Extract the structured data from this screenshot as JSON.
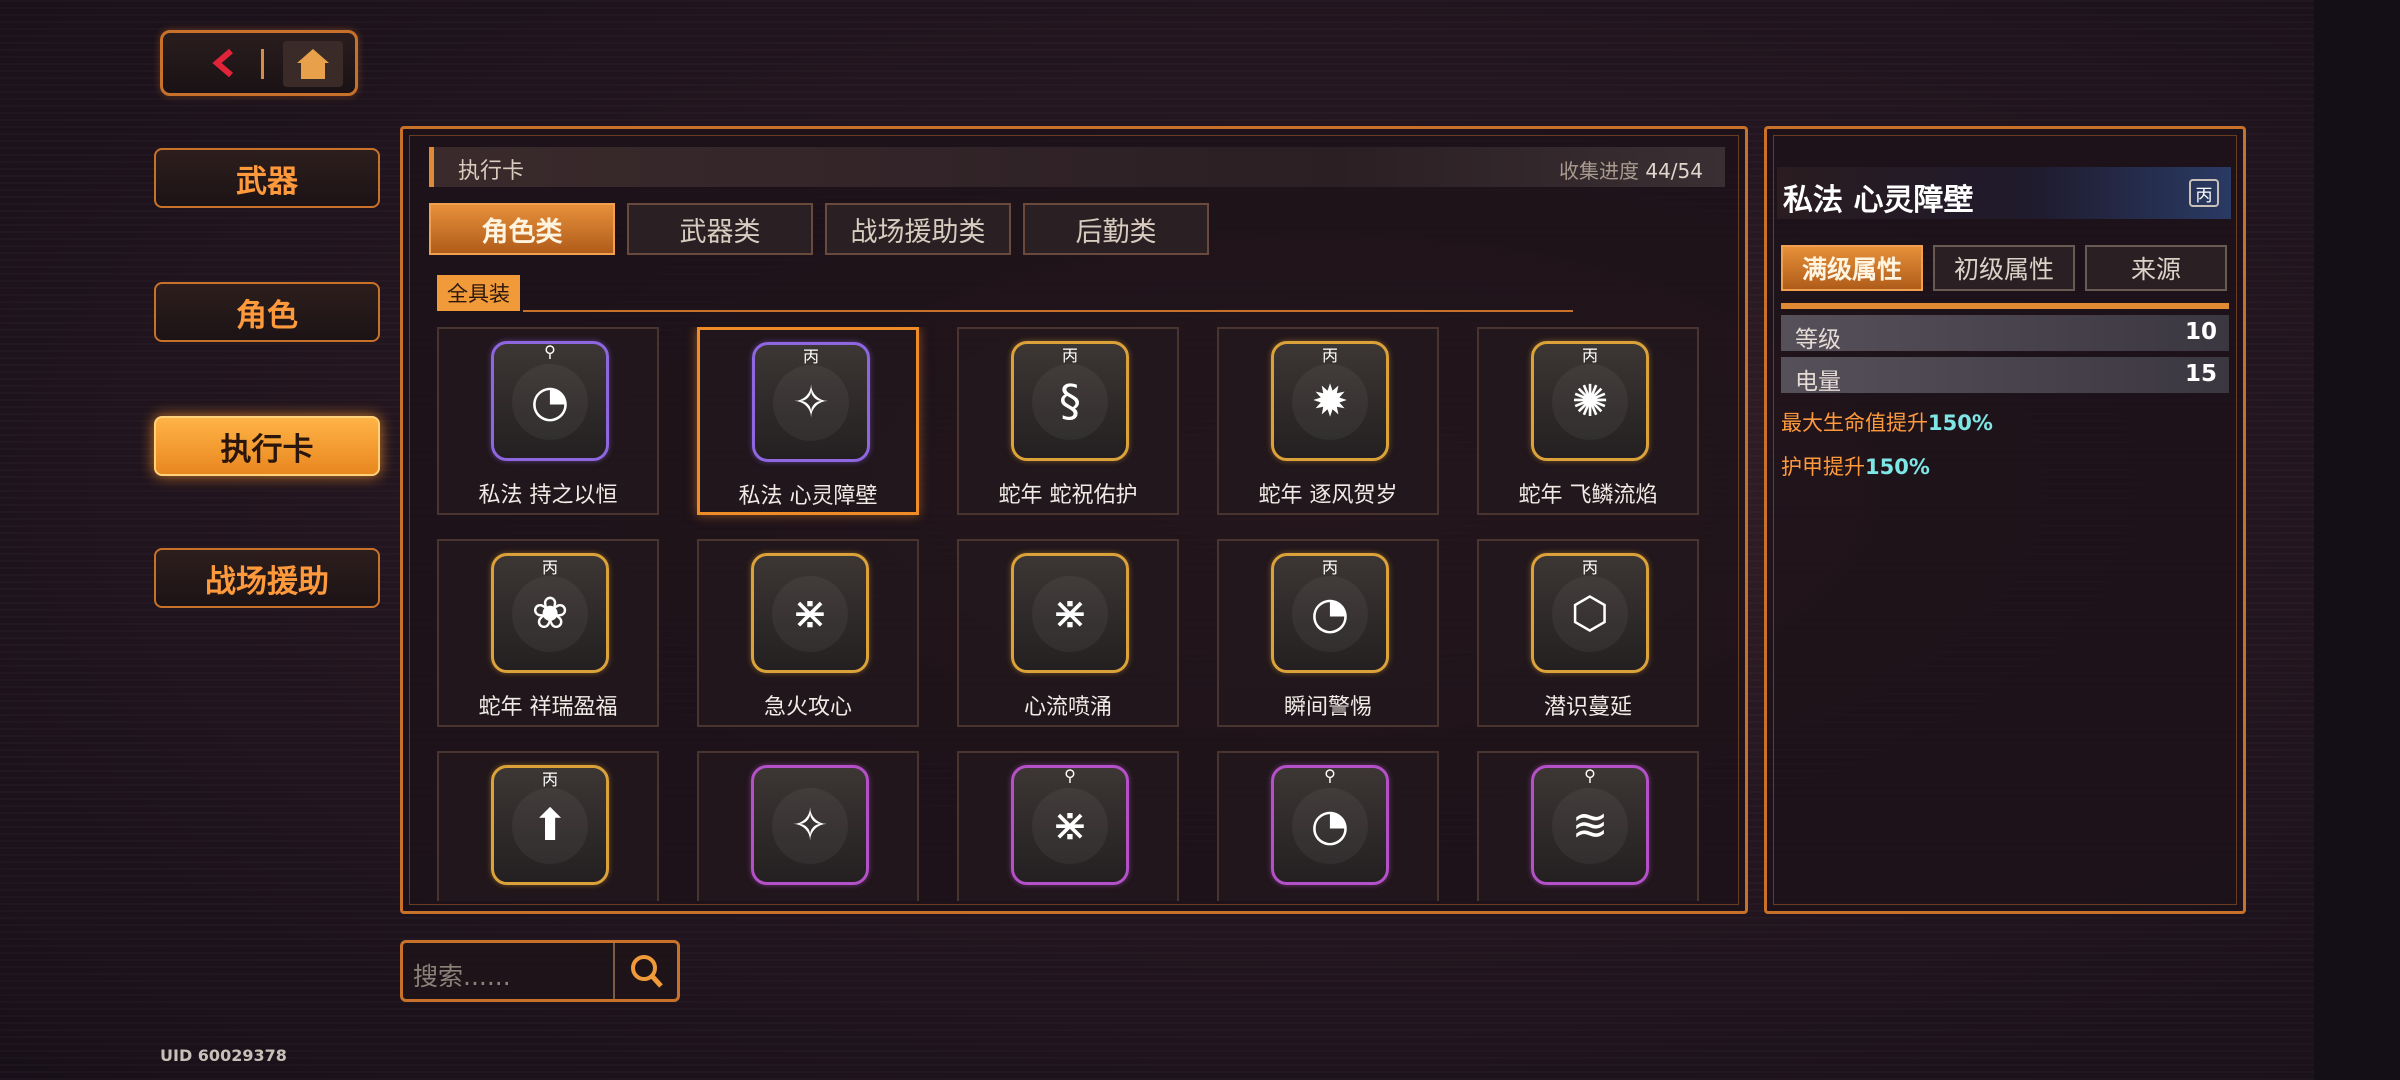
{
  "nav": {
    "back_icon": "back-arrow-icon",
    "home_icon": "home-icon"
  },
  "sidebar": {
    "items": [
      {
        "label": "武器"
      },
      {
        "label": "角色"
      },
      {
        "label": "执行卡",
        "active": true
      },
      {
        "label": "战场援助"
      }
    ]
  },
  "main": {
    "header_title": "执行卡",
    "progress_label": "收集进度",
    "progress_value": "44/54",
    "tabs": [
      {
        "label": "角色类",
        "active": true
      },
      {
        "label": "武器类"
      },
      {
        "label": "战场援助类"
      },
      {
        "label": "后勤类"
      }
    ],
    "filter_chip": "全具装",
    "cards": [
      {
        "name": "私法 持之以恒",
        "rank": "⚲",
        "frame": "purple",
        "icon": "shield-dial-icon",
        "glyph": "◔"
      },
      {
        "name": "私法 心灵障壁",
        "rank": "丙",
        "frame": "purple",
        "icon": "sparkle-hands-icon",
        "glyph": "✧",
        "selected": true
      },
      {
        "name": "蛇年 蛇祝佑护",
        "rank": "丙",
        "frame": "gold",
        "icon": "snake-ring-icon",
        "glyph": "§"
      },
      {
        "name": "蛇年 逐风贺岁",
        "rank": "丙",
        "frame": "gold",
        "icon": "firework-target-icon",
        "glyph": "✹"
      },
      {
        "name": "蛇年 飞鳞流焰",
        "rank": "丙",
        "frame": "gold",
        "icon": "diamond-burst-icon",
        "glyph": "✺"
      },
      {
        "name": "蛇年 祥瑞盈福",
        "rank": "丙",
        "frame": "gold",
        "icon": "lucky-bag-icon",
        "glyph": "❀"
      },
      {
        "name": "急火攻心",
        "rank": "",
        "frame": "gold",
        "icon": "spider-bug-icon",
        "glyph": "⋇"
      },
      {
        "name": "心流喷涌",
        "rank": "",
        "frame": "gold",
        "icon": "spider-bug-icon",
        "glyph": "⋇"
      },
      {
        "name": "瞬间警惕",
        "rank": "丙",
        "frame": "gold",
        "icon": "shield-dial-icon",
        "glyph": "◔"
      },
      {
        "name": "潜识蔓延",
        "rank": "丙",
        "frame": "gold",
        "icon": "hexagon-icon",
        "glyph": "⬡"
      },
      {
        "name": "",
        "rank": "丙",
        "frame": "gold",
        "icon": "rocket-icon",
        "glyph": "⬆"
      },
      {
        "name": "",
        "rank": "",
        "frame": "magenta",
        "icon": "sparkle-hands-icon",
        "glyph": "✧"
      },
      {
        "name": "",
        "rank": "⚲",
        "frame": "magenta",
        "icon": "spider-bug-icon",
        "glyph": "⋇"
      },
      {
        "name": "",
        "rank": "⚲",
        "frame": "magenta",
        "icon": "shield-dial-icon",
        "glyph": "◔"
      },
      {
        "name": "",
        "rank": "⚲",
        "frame": "magenta",
        "icon": "barbed-wire-icon",
        "glyph": "≋"
      }
    ]
  },
  "search": {
    "placeholder": "搜索......",
    "icon": "search-icon"
  },
  "uid": "UID 60029378",
  "detail": {
    "title": "私法 心灵障壁",
    "rank": "丙",
    "tabs": [
      {
        "label": "满级属性",
        "active": true
      },
      {
        "label": "初级属性"
      },
      {
        "label": "来源"
      }
    ],
    "stats": [
      {
        "label": "等级",
        "value": "10"
      },
      {
        "label": "电量",
        "value": "15"
      }
    ],
    "effects": [
      {
        "text": "最大生命值提升",
        "value": "150%"
      },
      {
        "text": "护甲提升",
        "value": "150%"
      }
    ]
  },
  "colors": {
    "accent": "#e08a33",
    "highlight": "#7fe6e6",
    "selected_frame": "#f08c28"
  }
}
